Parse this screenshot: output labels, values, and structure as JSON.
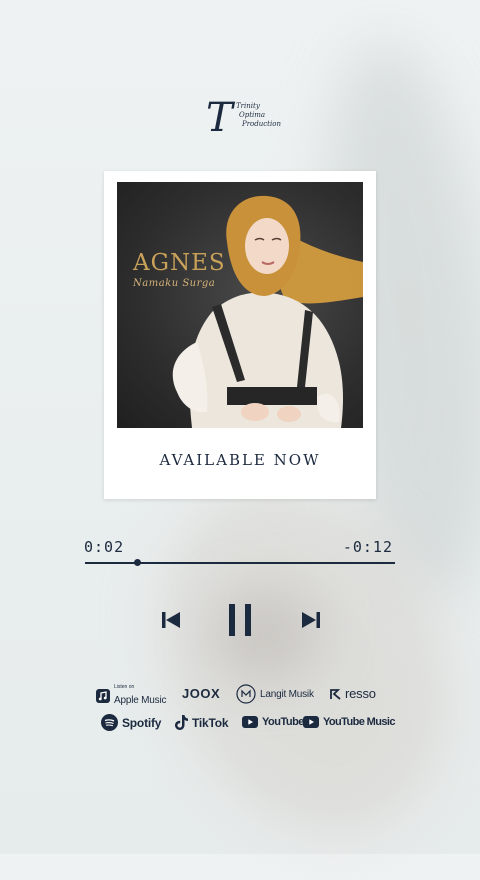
{
  "logo": {
    "monogram": "T",
    "line1": "Trinity",
    "line2": "Optima",
    "line3": "Production"
  },
  "album": {
    "artist": "AGNES",
    "song": "Namaku Surga",
    "status": "AVAILABLE NOW"
  },
  "player": {
    "elapsed": "0:02",
    "remaining": "-0:12",
    "progress": 0.17
  },
  "platforms_row1": [
    {
      "tag": "Listen on",
      "name": "Apple Music"
    },
    {
      "name": "JOOX"
    },
    {
      "name": "Langit Musik"
    },
    {
      "name": "resso"
    }
  ],
  "platforms_row2": [
    {
      "name": "Spotify"
    },
    {
      "name": "TikTok"
    },
    {
      "name": "YouTube"
    },
    {
      "name": "YouTube Music"
    }
  ],
  "colors": {
    "accent": "#1c2a3f",
    "gold": "#c9a25a",
    "scarf": "#d29b3e"
  },
  "icons": [
    "previous-icon",
    "pause-icon",
    "next-icon",
    "music-note-icon",
    "langit-logo-icon",
    "resso-logo-icon",
    "spotify-icon",
    "tiktok-icon",
    "youtube-icon",
    "youtube-music-icon"
  ]
}
